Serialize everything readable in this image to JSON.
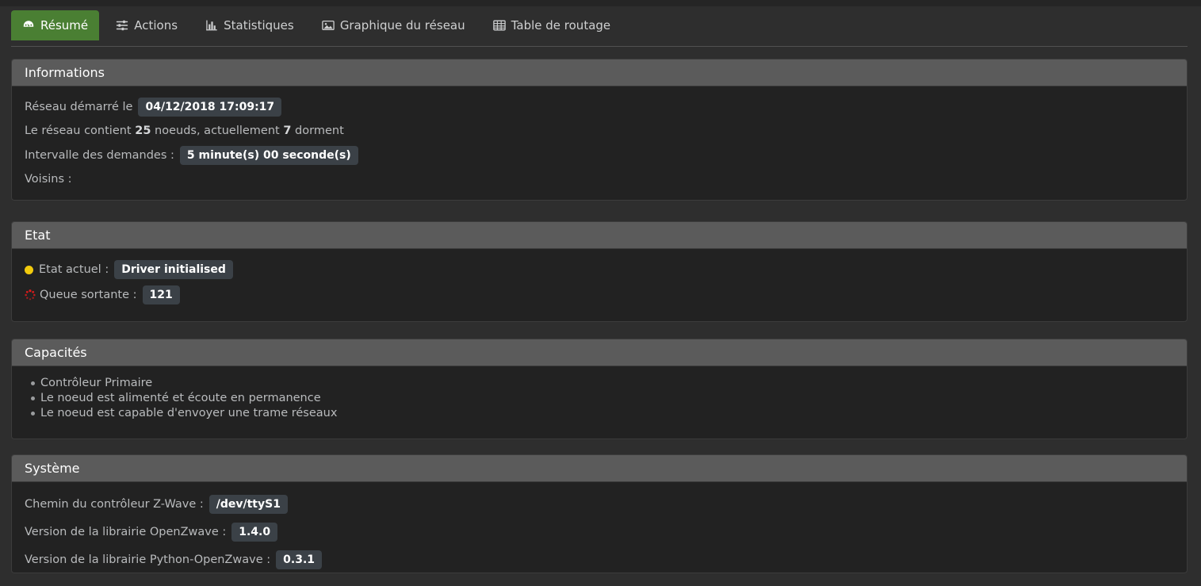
{
  "tabs": [
    {
      "label": "Résumé",
      "icon": "dashboard-icon",
      "active": true
    },
    {
      "label": "Actions",
      "icon": "sliders-icon",
      "active": false
    },
    {
      "label": "Statistiques",
      "icon": "bar-chart-icon",
      "active": false
    },
    {
      "label": "Graphique du réseau",
      "icon": "image-icon",
      "active": false
    },
    {
      "label": "Table de routage",
      "icon": "table-icon",
      "active": false
    }
  ],
  "informations": {
    "title": "Informations",
    "started_label": "Réseau démarré le",
    "started_value": "04/12/2018 17:09:17",
    "nodes_prefix": "Le réseau contient",
    "nodes_count": "25",
    "nodes_middle": "noeuds, actuellement",
    "sleeping_count": "7",
    "nodes_suffix": "dorment",
    "interval_label": "Intervalle des demandes :",
    "interval_value": "5 minute(s) 00 seconde(s)",
    "neighbours_label": "Voisins :",
    "neighbours_value": ""
  },
  "etat": {
    "title": "Etat",
    "current_label": "Etat actuel :",
    "current_value": "Driver initialised",
    "current_status_color": "#f2cb0d",
    "queue_label": "Queue sortante :",
    "queue_value": "121",
    "queue_spinner_color": "#e01b1b"
  },
  "capacites": {
    "title": "Capacités",
    "items": [
      "Contrôleur Primaire",
      "Le noeud est alimenté et écoute en permanence",
      "Le noeud est capable d'envoyer une trame réseaux"
    ]
  },
  "systeme": {
    "title": "Système",
    "controller_path_label": "Chemin du contrôleur Z-Wave :",
    "controller_path_value": "/dev/ttyS1",
    "openzwave_label": "Version de la librairie OpenZwave :",
    "openzwave_value": "1.4.0",
    "python_openzwave_label": "Version de la librairie Python-OpenZwave :",
    "python_openzwave_value": "0.3.1"
  },
  "theme": {
    "page_bg": "#2e2e2e",
    "panel_bg": "#222222",
    "panel_head_bg": "#5b5b5b",
    "accent_green": "#4a7f33",
    "badge_bg": "#3b4147",
    "text": "#b9bbbd"
  }
}
